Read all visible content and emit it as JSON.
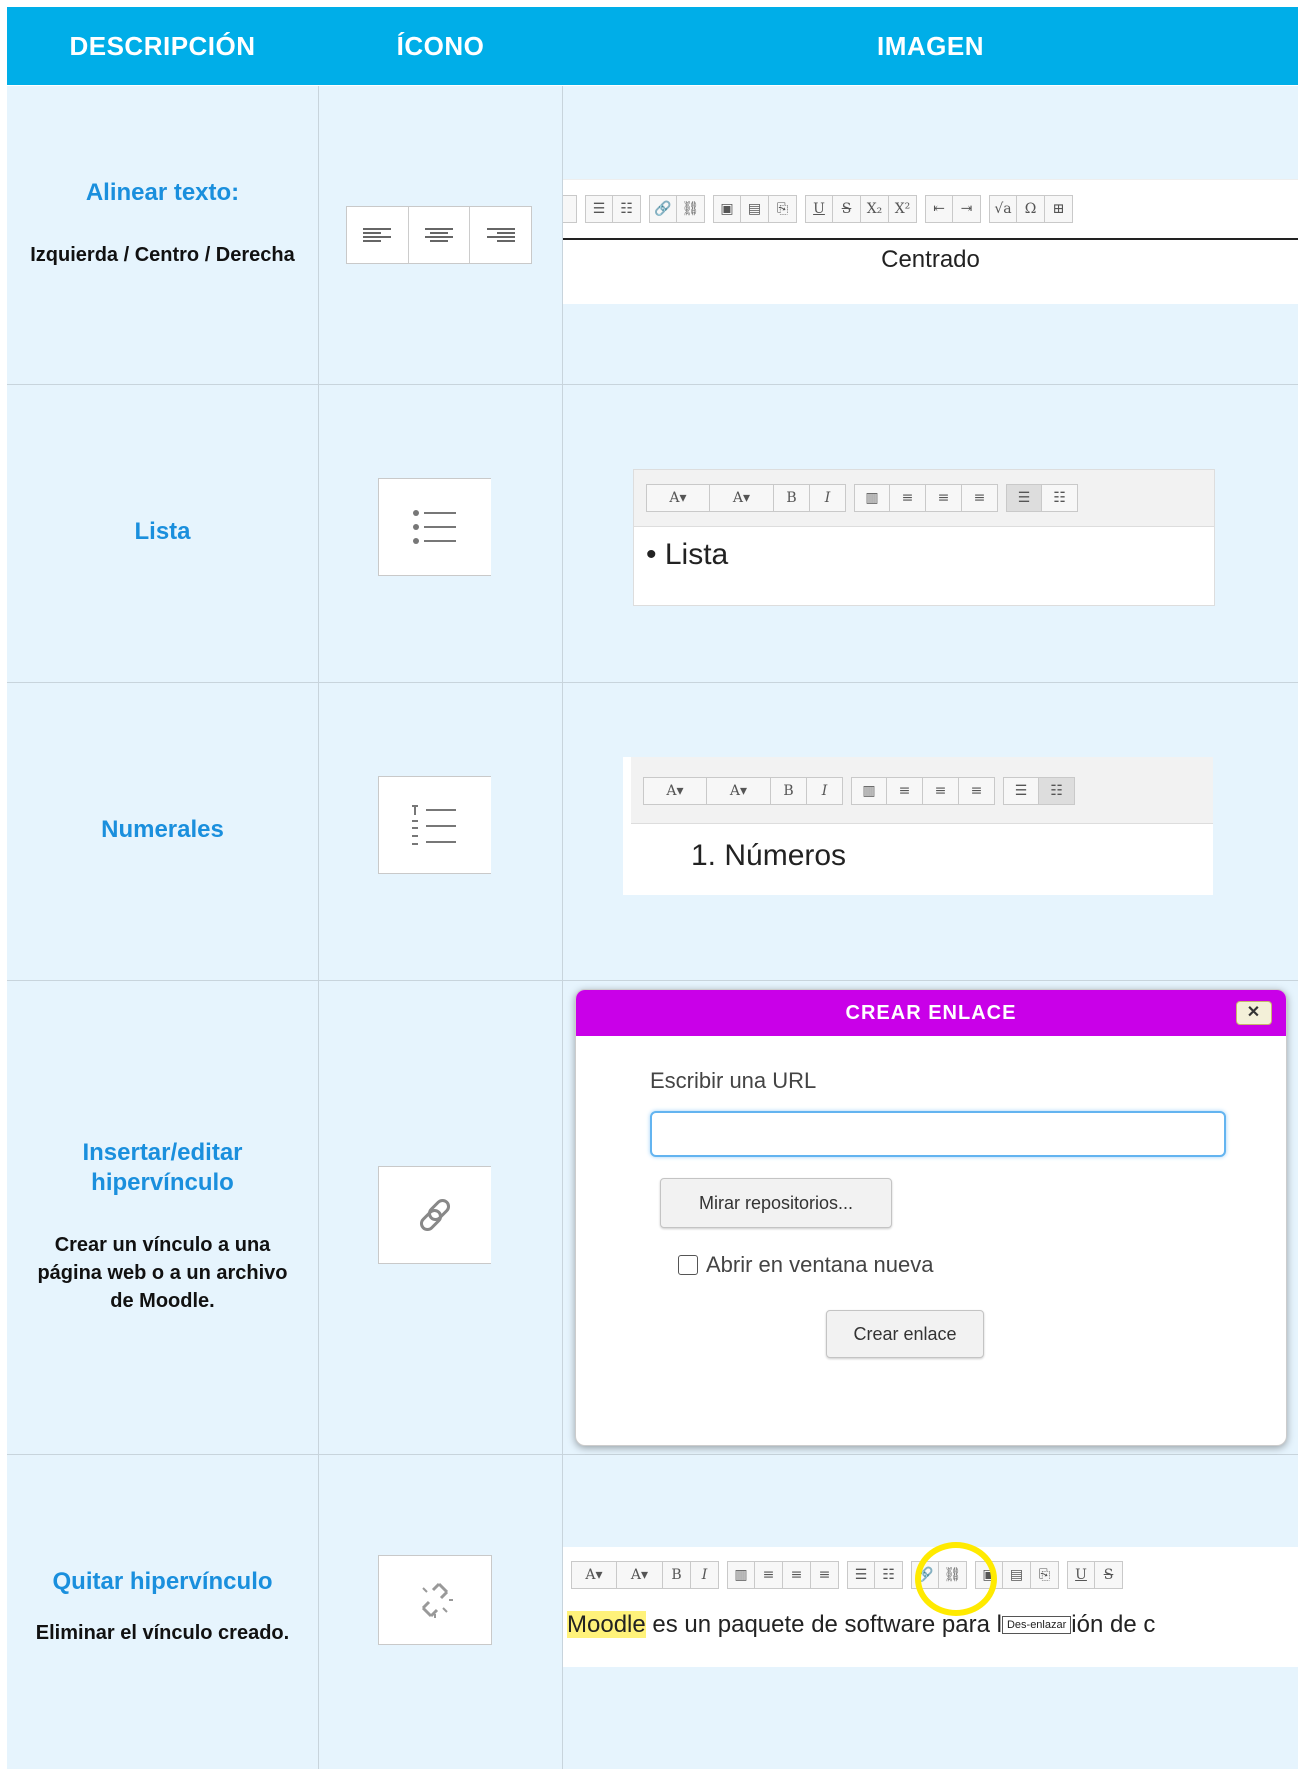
{
  "header": {
    "col1": "DESCRIPCIÓN",
    "col2": "ÍCONO",
    "col3": "IMAGEN"
  },
  "rows": [
    {
      "title": "Alinear texto:",
      "desc": "Izquierda / Centro / Derecha",
      "sample_text": "Centrado"
    },
    {
      "title": "Lista",
      "desc": "",
      "sample_text": "Lista"
    },
    {
      "title": "Numerales",
      "desc": "",
      "sample_text": "1. Números"
    },
    {
      "title": "Insertar/editar hipervínculo",
      "desc": "Crear un vínculo a una página web o a un archivo de Moodle."
    },
    {
      "title": "Quitar hipervínculo",
      "desc": "Eliminar el vínculo creado."
    }
  ],
  "dialog": {
    "title": "CREAR ENLACE",
    "close_label": "✕",
    "url_label": "Escribir una URL",
    "url_value": "",
    "browse_button": "Mirar repositorios...",
    "new_window_label": "Abrir en ventana nueva",
    "create_button": "Crear enlace"
  },
  "unlink_sample": {
    "highlight": "Moodle",
    "text_before": " es un paquete de software para l",
    "text_after": "ión de c",
    "tooltip": "Des-enlazar"
  },
  "colors": {
    "header": "#00aee8",
    "cell_bg": "#e6f4fd",
    "title": "#1a8fdd",
    "dialog_title": "#c900e8",
    "highlight": "#fff27a",
    "ring": "#ffea00"
  }
}
